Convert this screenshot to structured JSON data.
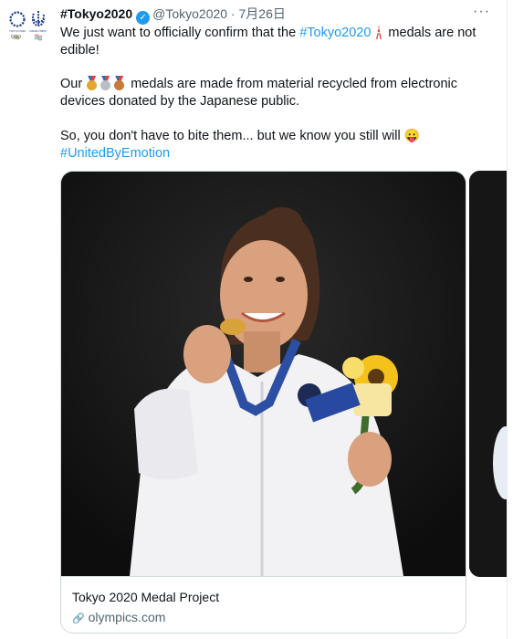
{
  "author": {
    "name": "#Tokyo2020",
    "handle": "@Tokyo2020",
    "separator": "·",
    "date": "7月26日",
    "verified_icon": "verified-badge-icon"
  },
  "more_icon": "···",
  "tweet": {
    "line1_prefix": "We just want to officially confirm that the ",
    "line1_hashtag": "#Tokyo2020",
    "line1_suffix": " medals are not edible!",
    "line2_prefix": "Our ",
    "line2_suffix": " medals are made from material recycled from electronic devices donated by the Japanese public.",
    "line3": "So, you don't have to bite them... but we know you still will ",
    "line3_emoji": "😛",
    "hashtag2": "#UnitedByEmotion"
  },
  "card": {
    "title": "Tokyo 2020 Medal Project",
    "domain": "olympics.com",
    "link_icon": "🔗"
  },
  "colors": {
    "link": "#1d9bf0",
    "text": "#0f1419",
    "secondary": "#536471"
  }
}
